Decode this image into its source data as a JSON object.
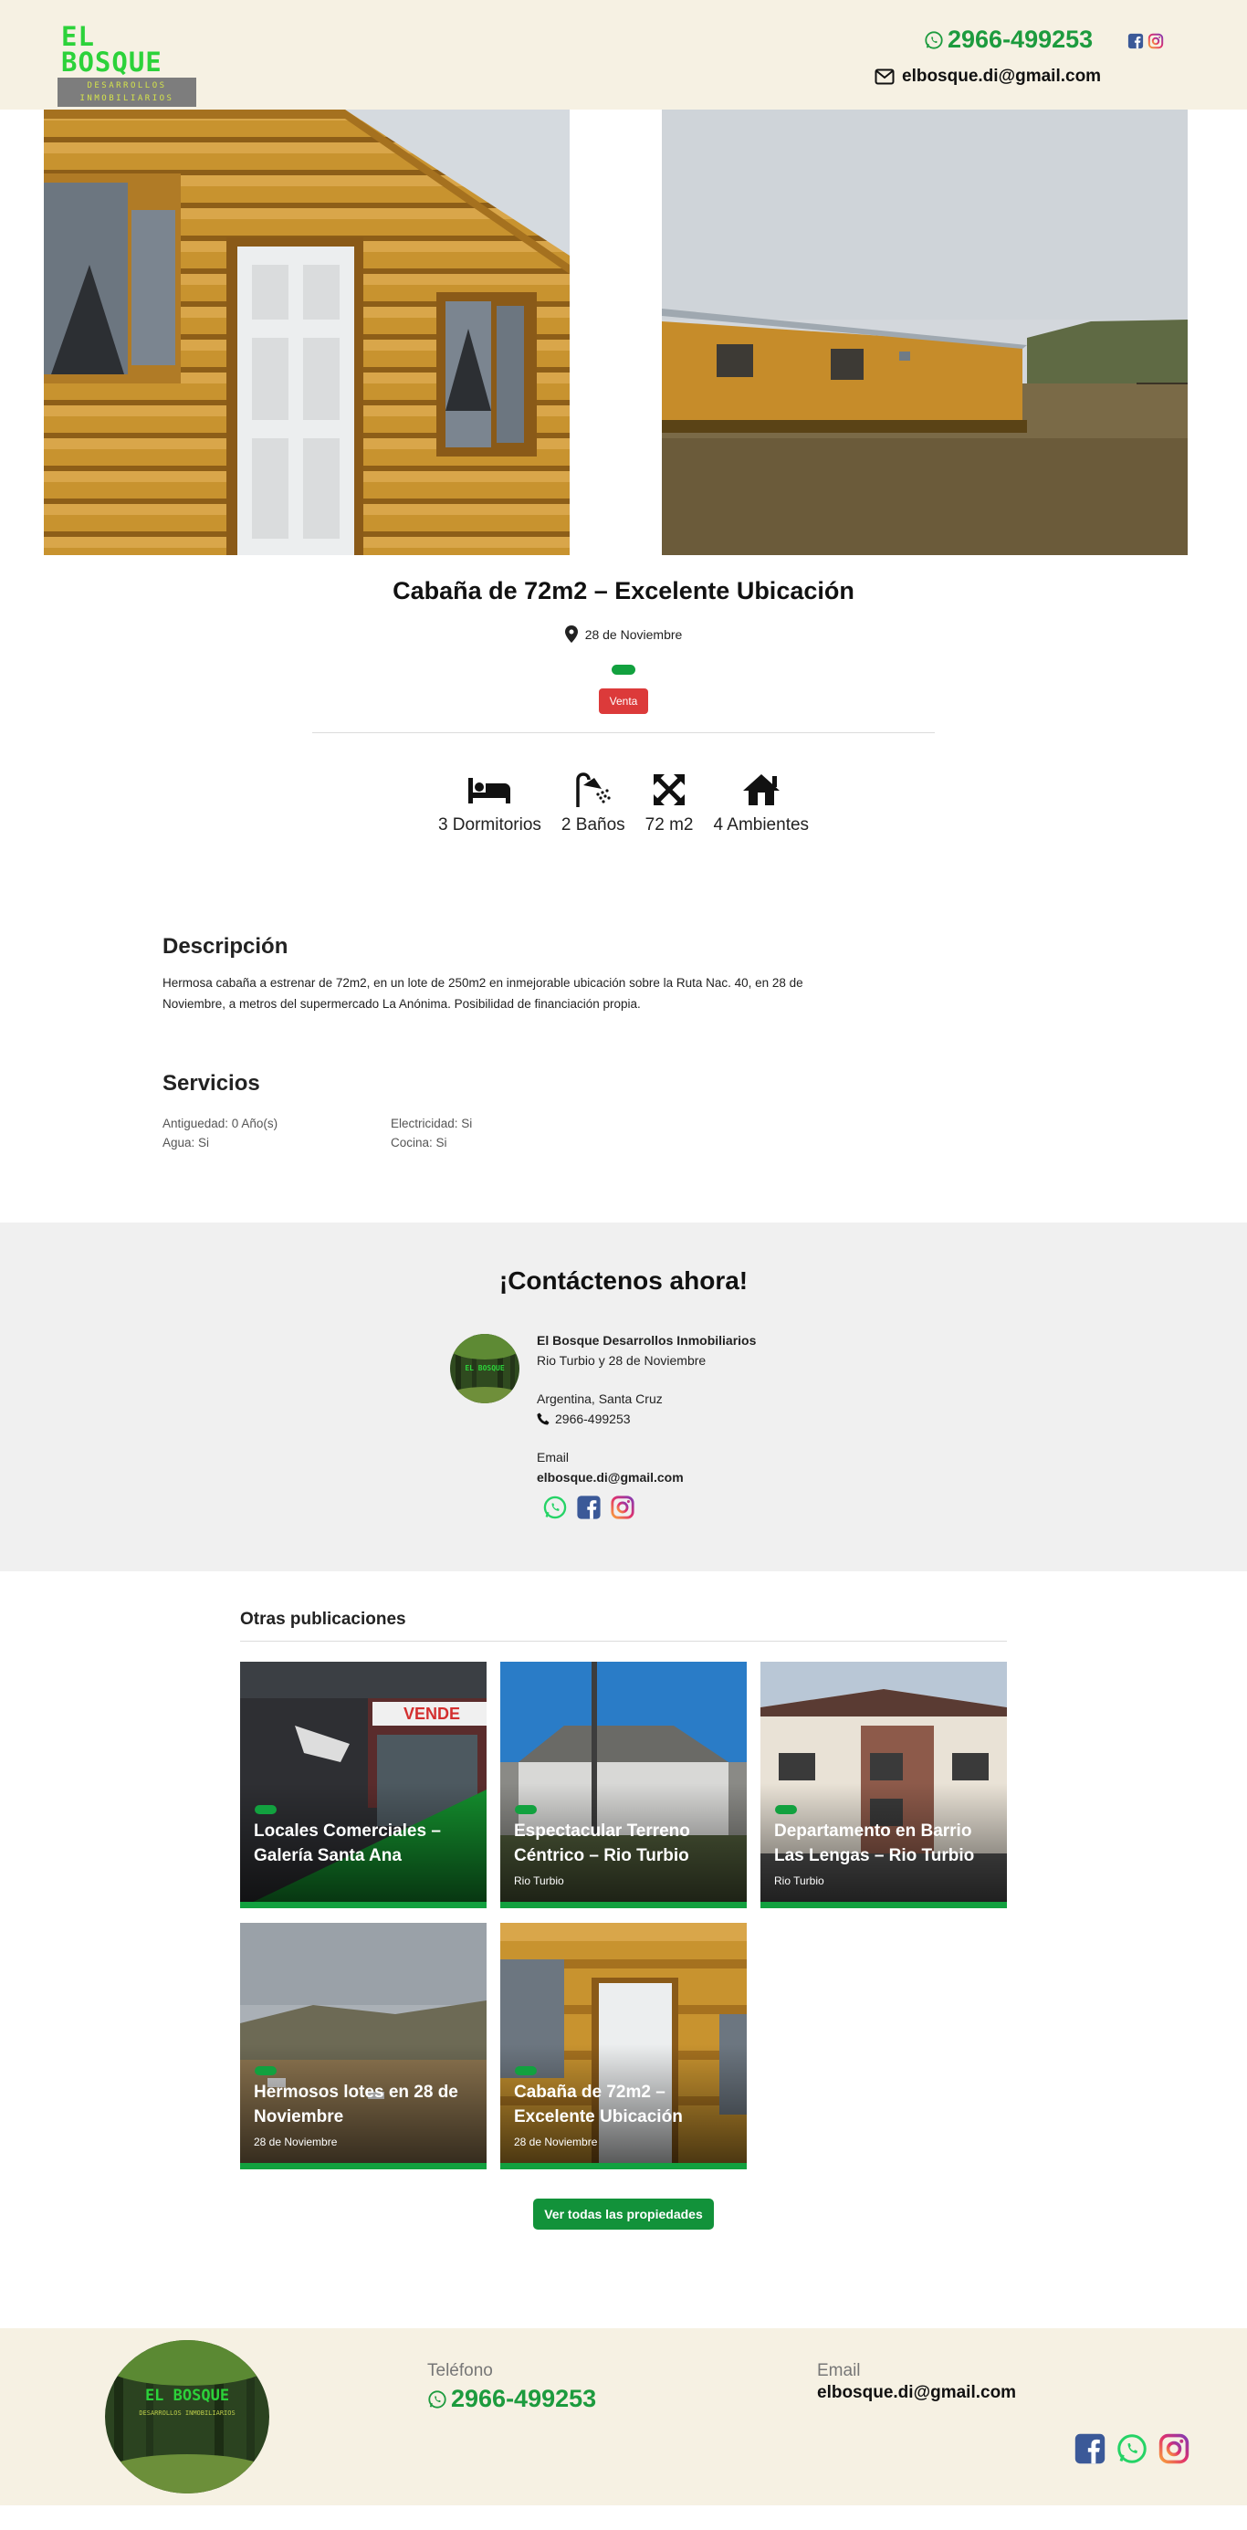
{
  "header": {
    "logo_title": "EL BOSQUE",
    "logo_subtitle": "DESARROLLOS INMOBILIARIOS",
    "phone": "2966-499253",
    "email": "elbosque.di@gmail.com"
  },
  "property": {
    "title": "Cabaña de 72m2 – Excelente Ubicación",
    "location": "28 de Noviembre",
    "badge": "Venta",
    "features": [
      {
        "icon": "bed-icon",
        "label": "3 Dormitorios"
      },
      {
        "icon": "shower-icon",
        "label": "2 Baños"
      },
      {
        "icon": "expand-arrows-icon",
        "label": "72 m2"
      },
      {
        "icon": "house-icon",
        "label": "4 Ambientes"
      }
    ],
    "description_heading": "Descripción",
    "description": "Hermosa cabaña a estrenar de 72m2, en un lote de 250m2 en inmejorable ubicación sobre la Ruta Nac. 40, en 28 de Noviembre, a metros del supermercado La Anónima. Posibilidad de financiación propia.",
    "services_heading": "Servicios",
    "services": [
      "Antiguedad: 0 Año(s)",
      "Electricidad: Si",
      "Agua: Si",
      "Cocina: Si"
    ]
  },
  "contact": {
    "heading": "¡Contáctenos ahora!",
    "company": "El Bosque Desarrollos Inmobiliarios",
    "address": "Rio Turbio y 28 de Noviembre",
    "region": "Argentina, Santa Cruz",
    "phone": "2966-499253",
    "email_label": "Email",
    "email": "elbosque.di@gmail.com",
    "avatar_text": "EL BOSQUE"
  },
  "others": {
    "heading": "Otras publicaciones",
    "cards": [
      {
        "title": "Locales Comerciales – Galería Santa Ana",
        "location": "",
        "sign": "VENDE"
      },
      {
        "title": "Espectacular Terreno Céntrico – Rio Turbio",
        "location": "Rio Turbio"
      },
      {
        "title": "Departamento en Barrio Las Lengas – Rio Turbio",
        "location": "Rio Turbio"
      },
      {
        "title": "Hermosos lotes en 28 de Noviembre",
        "location": "28 de Noviembre"
      },
      {
        "title": "Cabaña de 72m2 – Excelente Ubicación",
        "location": "28 de Noviembre"
      }
    ],
    "button": "Ver todas las propiedades"
  },
  "footer": {
    "phone_label": "Teléfono",
    "phone": "2966-499253",
    "email_label": "Email",
    "email": "elbosque.di@gmail.com",
    "logo_title": "EL BOSQUE",
    "logo_subtitle": "DESARROLLOS INMOBILIARIOS"
  },
  "colors": {
    "brand_green": "#12a13f",
    "logo_green": "#2cd23a",
    "header_bg": "#f6f1e3",
    "venta_red": "#dc3a3a",
    "facebook": "#3b5998",
    "whatsapp": "#25d366"
  }
}
